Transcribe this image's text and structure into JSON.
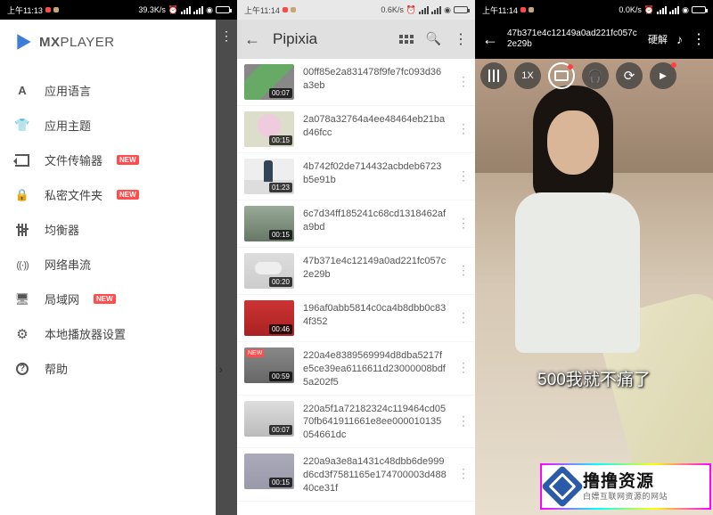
{
  "panel1": {
    "status": {
      "time": "上午11:13",
      "speed": "39.3K/s",
      "battery": "63"
    },
    "brand": "MXPLAYER",
    "menu": [
      {
        "label": "应用语言",
        "icon": "a",
        "badge": false,
        "chevron": false
      },
      {
        "label": "应用主题",
        "icon": "shirt",
        "badge": false,
        "chevron": false
      },
      {
        "label": "文件传输器",
        "icon": "trans",
        "badge": true,
        "chevron": false
      },
      {
        "label": "私密文件夹",
        "icon": "lock",
        "badge": true,
        "chevron": false
      },
      {
        "label": "均衡器",
        "icon": "eq",
        "badge": false,
        "chevron": false
      },
      {
        "label": "网络串流",
        "icon": "stream",
        "badge": false,
        "chevron": false
      },
      {
        "label": "局域网",
        "icon": "lan",
        "badge": true,
        "chevron": false
      },
      {
        "label": "本地播放器设置",
        "icon": "gear",
        "badge": false,
        "chevron": false
      },
      {
        "label": "帮助",
        "icon": "help",
        "badge": false,
        "chevron": true
      }
    ],
    "badge_text": "NEW"
  },
  "panel2": {
    "status": {
      "time": "上午11:14",
      "speed": "0.6K/s",
      "battery": "63"
    },
    "title": "Pipixia",
    "files": [
      {
        "name": "00ff85e2a831478f9fe7fc093d36a3eb",
        "dur": "00:07",
        "new": false,
        "th": "th0"
      },
      {
        "name": "2a078a32764a4ee48464eb21bad46fcc",
        "dur": "00:15",
        "new": false,
        "th": "th1"
      },
      {
        "name": "4b742f02de714432acbdeb6723b5e91b",
        "dur": "01:23",
        "new": false,
        "th": "th2"
      },
      {
        "name": "6c7d34ff185241c68cd1318462afa9bd",
        "dur": "00:15",
        "new": false,
        "th": "th3"
      },
      {
        "name": "47b371e4c12149a0ad221fc057c2e29b",
        "dur": "00:20",
        "new": false,
        "th": "th4"
      },
      {
        "name": "196af0abb5814c0ca4b8dbb0c834f352",
        "dur": "00:46",
        "new": false,
        "th": "th5"
      },
      {
        "name": "220a4e8389569994d8dba5217fe5ce39ea6116611d23000008bdf5a202f5",
        "dur": "00:59",
        "new": true,
        "th": "th6"
      },
      {
        "name": "220a5f1a72182324c119464cd0570fb641911661e8ee000010135054661dc",
        "dur": "00:07",
        "new": false,
        "th": "th7"
      },
      {
        "name": "220a9a3e8a1431c48dbb6de999d6cd3f7581165e174700003d48840ce31f",
        "dur": "00:15",
        "new": false,
        "th": "th8"
      }
    ]
  },
  "panel3": {
    "status": {
      "time": "上午11:14",
      "speed": "0.0K/s",
      "battery": "63"
    },
    "title": "47b371e4c12149a0ad221fc057c2e29b",
    "hw_label": "硬解",
    "speed_label": "1X",
    "caption": "500我就不痛了",
    "watermark_big": "撸撸资源",
    "watermark_small": "白嫖互联网资源的网站"
  }
}
